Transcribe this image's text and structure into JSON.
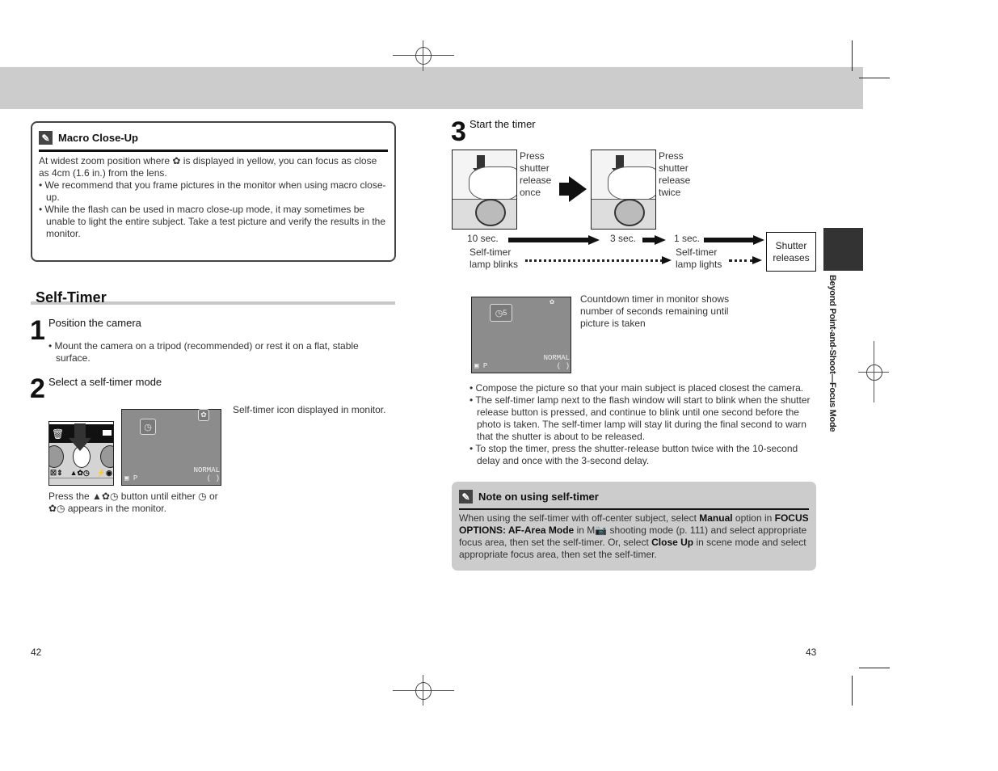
{
  "left_page": {
    "macro_box": {
      "icon": "pencil-note-icon",
      "title": "Macro Close-Up",
      "intro": "At widest zoom position where ✿ is displayed in yellow, you can focus as close as 4cm (1.6 in.) from the lens.",
      "bullets": [
        "We recommend that you frame pictures in the monitor when using macro close-up.",
        "While the flash can be used in macro close-up mode, it may sometimes be unable to light the entire subject. Take a test picture and verify the results in the monitor."
      ]
    },
    "section_title": "Self-Timer",
    "step1": {
      "number": "1",
      "title": "Position the camera",
      "bullets": [
        "Mount the camera on a tripod (recommended) or rest it on a flat, stable surface."
      ]
    },
    "step2": {
      "number": "2",
      "title": "Select a self-timer mode",
      "monitor_caption": "Self-timer icon displayed in monitor.",
      "press_caption": "Press the ▲✿◷ button until either ◷ or ✿◷ appears in the monitor.",
      "panel_labels": {
        "trash": "🗑",
        "left": "☒⇕",
        "center": "▲✿◷",
        "right": "⚡◉"
      },
      "monitor_labels": {
        "mode": "P",
        "quality": "NORMAL",
        "bracket": "(    )"
      }
    },
    "page_number": "42"
  },
  "right_page": {
    "step3": {
      "number": "3",
      "title": "Start the timer",
      "press_once": [
        "Press",
        "shutter",
        "release",
        "once"
      ],
      "press_twice": [
        "Press",
        "shutter",
        "release",
        "twice"
      ],
      "timeline": {
        "t10": "10 sec.",
        "t3": "3 sec.",
        "t1": "1 sec.",
        "blinks": [
          "Self-timer",
          "lamp blinks"
        ],
        "lights": [
          "Self-timer",
          "lamp lights"
        ],
        "result": [
          "Shutter",
          "releases"
        ]
      },
      "countdown_caption": "Countdown timer in monitor shows number of seconds remaining until picture is taken",
      "countdown_value": "5",
      "monitor_labels": {
        "mode": "P",
        "quality": "NORMAL",
        "bracket": "(    )"
      },
      "bullets": [
        "Compose the picture so that your main subject is placed closest the camera.",
        "The self-timer lamp next to the flash window will start to blink when the shutter release button is pressed, and continue to blink until one second before the photo is taken. The self-timer lamp will stay lit during the final second to warn that the shutter is about to be released.",
        "To stop the timer, press the shutter-release button twice with the 10-second delay and once with the 3-second delay."
      ]
    },
    "note_box": {
      "icon": "pencil-note-icon",
      "title": "Note on using self-timer",
      "segments": [
        {
          "t": "When using the self-timer with off-center subject, select ",
          "b": false
        },
        {
          "t": "Manual",
          "b": true
        },
        {
          "t": " option in ",
          "b": false
        },
        {
          "t": "FOCUS OPTIONS: AF-Area Mode",
          "b": true
        },
        {
          "t": " in M📷 shooting mode (p. 111) and select appropriate focus area, then set the self-timer. Or, select ",
          "b": false
        },
        {
          "t": "Close Up",
          "b": true
        },
        {
          "t": " in scene mode and select appropriate focus area, then set the self-timer.",
          "b": false
        }
      ]
    },
    "side_label": "Beyond Point-and-Shoot—Focus Mode",
    "page_number": "43"
  },
  "colors": {
    "header_band": "#cccccc",
    "note_bg": "#cccccc",
    "side_tab": "#333333",
    "monitor_bg": "#8c8c8c"
  }
}
